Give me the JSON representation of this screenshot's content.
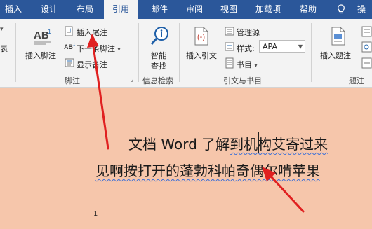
{
  "tabs": [
    {
      "label": "插入",
      "active": false
    },
    {
      "label": "设计",
      "active": false
    },
    {
      "label": "布局",
      "active": false
    },
    {
      "label": "引用",
      "active": true
    },
    {
      "label": "邮件",
      "active": false
    },
    {
      "label": "审阅",
      "active": false
    },
    {
      "label": "视图",
      "active": false
    },
    {
      "label": "加载项",
      "active": false
    },
    {
      "label": "帮助",
      "active": false
    },
    {
      "label": "操",
      "active": false
    }
  ],
  "ribbon": {
    "footnotes": {
      "insert_footnote": "插入脚注",
      "insert_endnote": "插入尾注",
      "next_footnote": "下一条脚注",
      "show_notes": "显示备注",
      "group_label": "脚注"
    },
    "research": {
      "smart_lookup_line1": "智能",
      "smart_lookup_line2": "查找",
      "group_label": "信息检索"
    },
    "citations": {
      "insert_citation": "插入引文",
      "manage_sources": "管理源",
      "style_label": "样式:",
      "style_value": "APA",
      "bibliography": "书目",
      "group_label": "引文与书目"
    },
    "captions": {
      "insert_caption": "插入题注",
      "group_label": "题注"
    }
  },
  "document": {
    "line1": {
      "a": "文档  Word  了解",
      "b": "到机构艾寄过来"
    },
    "line2": {
      "a": "见啊按打开的",
      "b": "蓬勃科帕",
      "c": "奇偶尔啃苹果"
    },
    "page_number": "1"
  },
  "colors": {
    "tab_bar": "#2b579a",
    "ribbon": "#f3f3f3",
    "page": "#f6c6ab",
    "arrow": "#e02020"
  }
}
